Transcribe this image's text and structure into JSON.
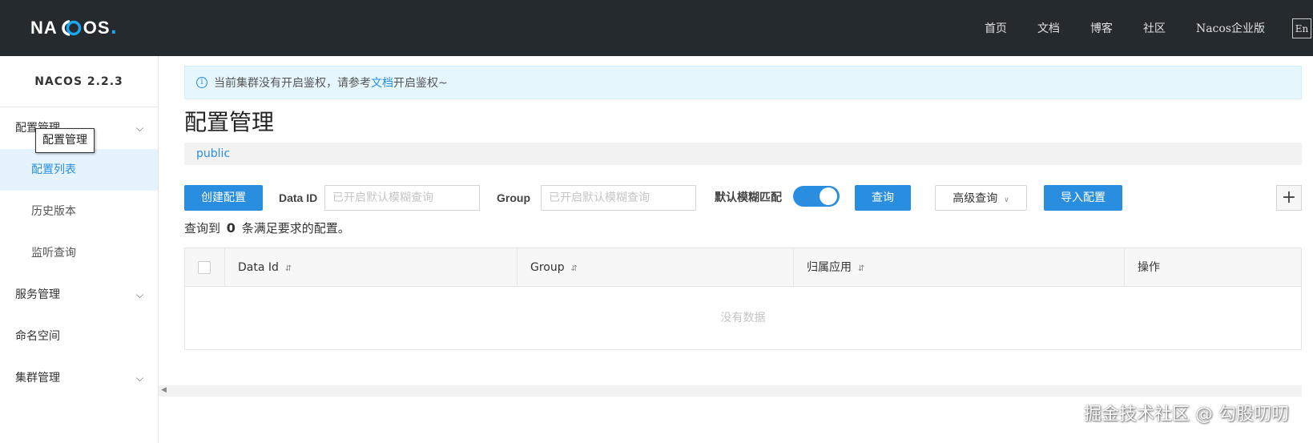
{
  "header": {
    "logo_text_a": "NA",
    "logo_text_b": "OS",
    "logo_dot": ".",
    "nav": [
      "首页",
      "文档",
      "博客",
      "社区",
      "Nacos企业版"
    ],
    "lang": "En"
  },
  "sidebar": {
    "version": "NACOS 2.2.3",
    "groups": [
      {
        "label": "配置管理",
        "items": [
          "配置列表",
          "历史版本",
          "监听查询"
        ]
      },
      {
        "label": "服务管理"
      },
      {
        "label": "命名空间"
      },
      {
        "label": "集群管理"
      }
    ],
    "tooltip": "配置管理"
  },
  "main": {
    "notice": {
      "icon": "info-icon",
      "prefix": "当前集群没有开启鉴权，请参考",
      "link": "文档",
      "suffix": "开启鉴权~"
    },
    "title": "配置管理",
    "namespace": "public",
    "toolbar": {
      "create_label": "创建配置",
      "data_id_label": "Data ID",
      "data_id_placeholder": "已开启默认模糊查询",
      "group_label": "Group",
      "group_placeholder": "已开启默认模糊查询",
      "fuzzy_label": "默认模糊匹配",
      "fuzzy_on": true,
      "query_label": "查询",
      "advanced_label": "高级查询",
      "import_label": "导入配置",
      "plus_label": "+"
    },
    "result": {
      "prefix": "查询到",
      "count": "0",
      "suffix": "条满足要求的配置。"
    },
    "table": {
      "columns": [
        "Data Id",
        "Group",
        "归属应用",
        "操作"
      ],
      "empty": "没有数据"
    }
  },
  "watermark": "掘金技术社区 @ 勾股叨叨",
  "colors": {
    "header_bg": "#252a2f",
    "primary": "#2a8ee0",
    "notice_bg": "#e6f6fd",
    "active_bg": "#e5f4fc"
  }
}
